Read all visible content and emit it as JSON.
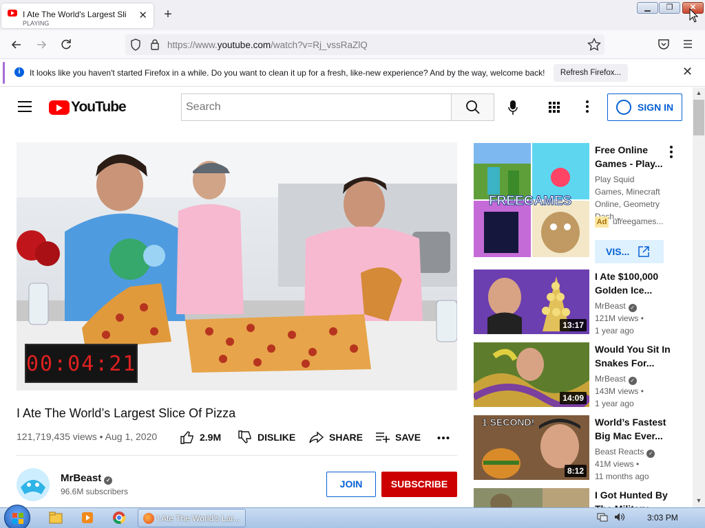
{
  "browser": {
    "tab_title": "I Ate The World's Largest Slice O",
    "tab_status": "PLAYING",
    "url_prefix": "https://www.",
    "url_domain": "youtube.com",
    "url_path": "/watch?v=Rj_vssRaZlQ",
    "notification": "It looks like you haven't started Firefox in a while. Do you want to clean it up for a fresh, like-new experience? And by the way, welcome back!",
    "refresh_label": "Refresh Firefox..."
  },
  "youtube": {
    "logo_text": "YouTube",
    "search_placeholder": "Search",
    "sign_in": "SIGN IN"
  },
  "video": {
    "timer": "00:04:21",
    "title": "I Ate The World’s Largest Slice Of Pizza",
    "meta": "121,719,435 views • Aug 1, 2020",
    "likes": "2.9M",
    "dislike": "DISLIKE",
    "share": "SHARE",
    "save": "SAVE",
    "channel": "MrBeast",
    "subscribers": "96.6M subscribers",
    "join": "JOIN",
    "subscribe": "SUBSCRIBE"
  },
  "ad": {
    "title": "Free Online Games - Play...",
    "description": "Play Squid Games, Minecraft Online, Geometry Dash,...",
    "badge": "Ad",
    "domain": "ufreegames...",
    "visit": "VIS...",
    "thumb_text": "FREEGAMES"
  },
  "related": [
    {
      "title": "I Ate $100,000 Golden Ice...",
      "channel": "MrBeast",
      "views": "121M views •",
      "age": "1 year ago",
      "duration": "13:17"
    },
    {
      "title": "Would You Sit In Snakes For...",
      "channel": "MrBeast",
      "views": "143M views •",
      "age": "1 year ago",
      "duration": "14:09"
    },
    {
      "title": "World’s Fastest Big Mac Ever...",
      "channel": "Beast Reacts",
      "views": "41M views •",
      "age": "11 months ago",
      "duration": "8:12",
      "overlay": "1 SECOND!"
    },
    {
      "title": "I Got Hunted By The Military",
      "channel": "",
      "views": "",
      "age": "",
      "duration": ""
    }
  ],
  "taskbar": {
    "task_label": "I Ate The World's Lar...",
    "clock": "3:03 PM"
  }
}
